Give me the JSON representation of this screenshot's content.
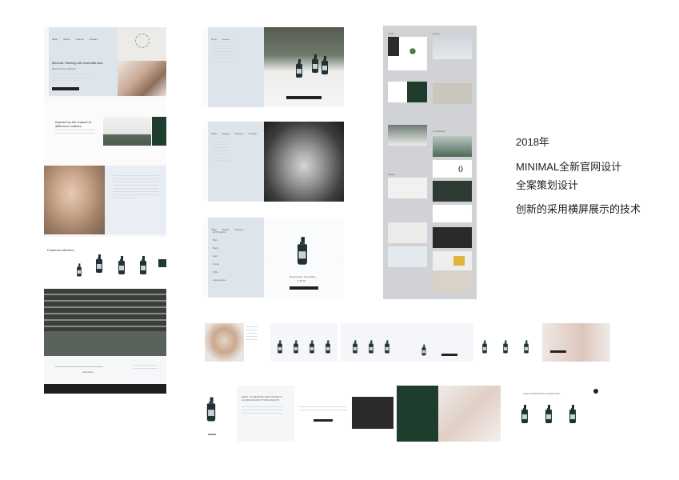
{
  "nav": {
    "items": [
      "Shop",
      "Stores",
      "Journal",
      "Contact"
    ]
  },
  "panel1": {
    "heading": "Minimal: Starting with essential care",
    "sub": "Discover the collection",
    "quote": "Inspired by the respect to difference cultures",
    "featured_title": "Featured collection",
    "footer_btn": "Subscribe"
  },
  "panel2": {
    "menu": [
      "All Products",
      "Skin",
      "Body",
      "Hair",
      "Home",
      "Gifts",
      "Accessories"
    ],
    "product_name": "Resurrection Hand Balm",
    "product_price": "$ 35.00"
  },
  "grid": {
    "origin": "Origin",
    "stories": "Stories",
    "design": "Design",
    "certification": "Certification",
    "zero": "0"
  },
  "bottom": {
    "collection_title": "THE FOUNDATION COLLECTION",
    "email_prompt": "EMAIL TO RECEIVE NEW PRODUCT LAUNCHES AND STORE EVENTS"
  },
  "tech": {
    "year": "2018年",
    "line1": "MINIMAL全新官网设计",
    "line2": "全案策划设计",
    "line3": "创新的采用横屏展示的技术"
  },
  "colors": {
    "accent_green": "#1f3d2c",
    "panel_blue": "#dde4ec",
    "dark": "#222222"
  }
}
